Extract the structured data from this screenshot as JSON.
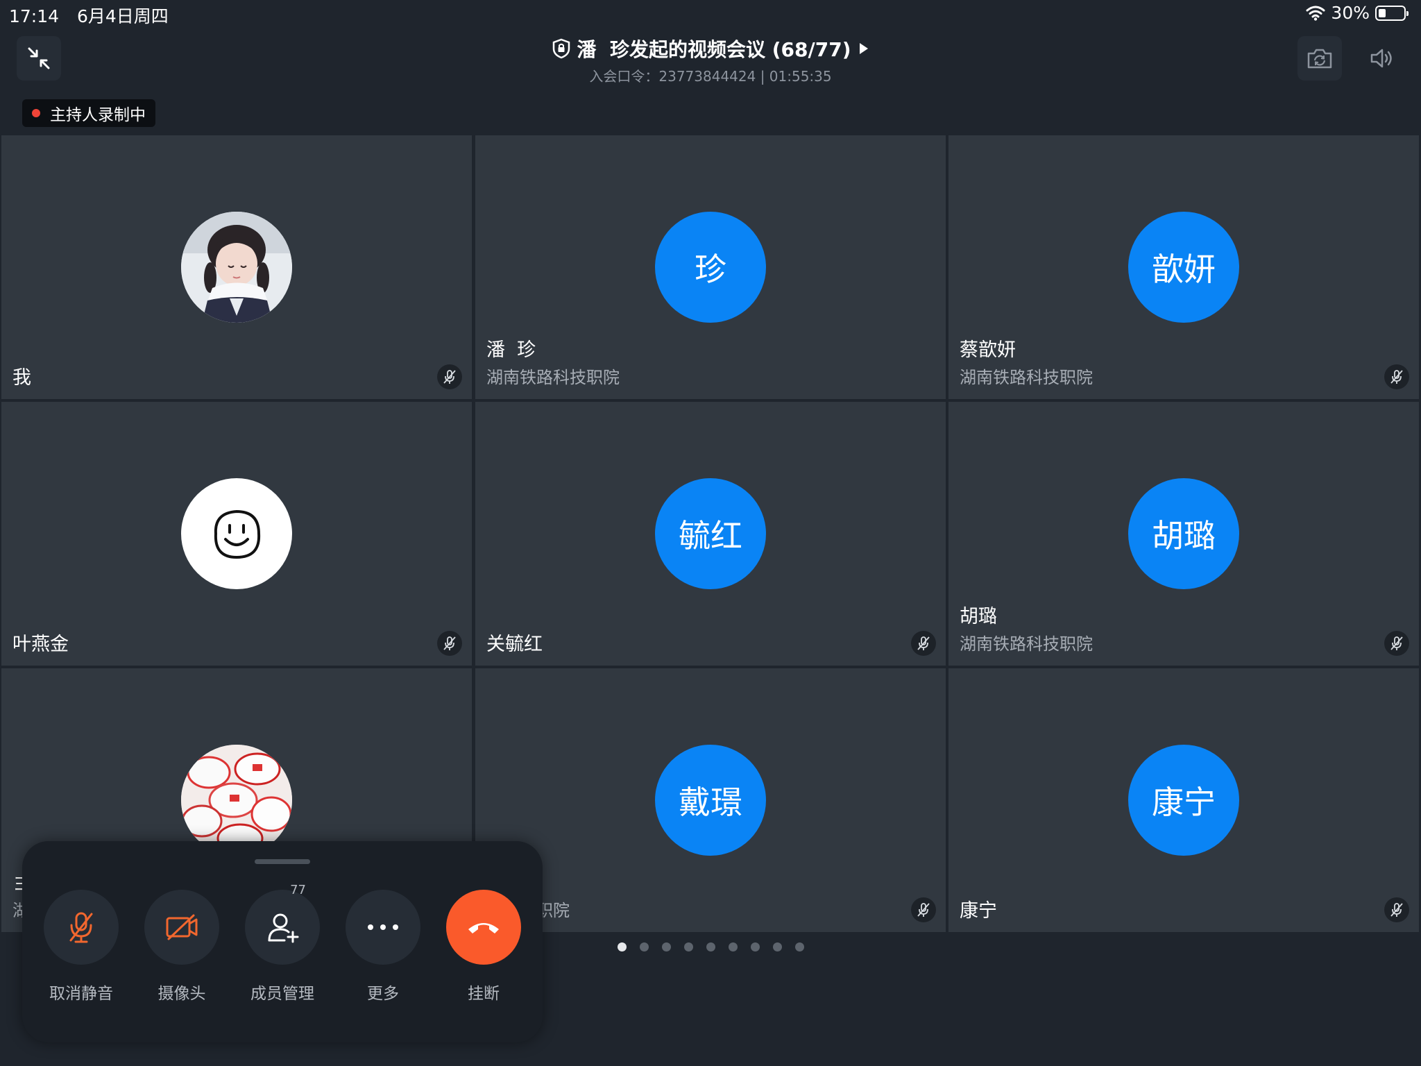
{
  "status_bar": {
    "time": "17:14",
    "date": "6月4日周四",
    "battery": "30%",
    "battery_level": 0.3
  },
  "header": {
    "title": "潘  珍发起的视频会议 (68/77)",
    "subtitle": "入会口令：23773844424 | 01:55:35",
    "icons": [
      "collapse-icon",
      "lock-shield-icon",
      "play-arrow-icon",
      "camera-switch-icon",
      "speaker-icon"
    ]
  },
  "recording": {
    "label": "主持人录制中",
    "color": "#f04438"
  },
  "participants": [
    {
      "name": "我",
      "org": "",
      "avatar_text": "",
      "avatar_type": "photo-girl",
      "muted": true
    },
    {
      "name": "潘  珍",
      "org": "湖南铁路科技职院",
      "avatar_text": "珍",
      "avatar_type": "initials",
      "muted": false
    },
    {
      "name": "蔡歆妍",
      "org": "湖南铁路科技职院",
      "avatar_text": "歆妍",
      "avatar_type": "initials",
      "muted": true
    },
    {
      "name": "叶燕金",
      "org": "",
      "avatar_text": "",
      "avatar_type": "smiley",
      "muted": true
    },
    {
      "name": "关毓红",
      "org": "",
      "avatar_text": "毓红",
      "avatar_type": "initials",
      "muted": true
    },
    {
      "name": "胡璐",
      "org": "湖南铁路科技职院",
      "avatar_text": "胡璐",
      "avatar_type": "initials",
      "muted": true
    },
    {
      "name": "",
      "org": "",
      "avatar_text": "",
      "avatar_type": "photo-candy",
      "muted": false
    },
    {
      "name": "",
      "org": "路科技职院",
      "avatar_text": "戴璟",
      "avatar_type": "initials",
      "muted": true
    },
    {
      "name": "康宁",
      "org": "",
      "avatar_text": "康宁",
      "avatar_type": "initials",
      "muted": true
    }
  ],
  "partial_text": {
    "tile7_name": "ヨ",
    "tile7_org": "湖"
  },
  "pagination": {
    "pages": 9,
    "current": 1
  },
  "controls": {
    "unmute": "取消静音",
    "camera": "摄像头",
    "members": "成员管理",
    "members_count": "77",
    "more": "更多",
    "hangup": "挂断"
  },
  "colors": {
    "background": "#1f252d",
    "tile": "#313840",
    "avatar_blue": "#0a84f5",
    "danger": "#fa5a2b",
    "muted_icon": "#f2672e"
  }
}
